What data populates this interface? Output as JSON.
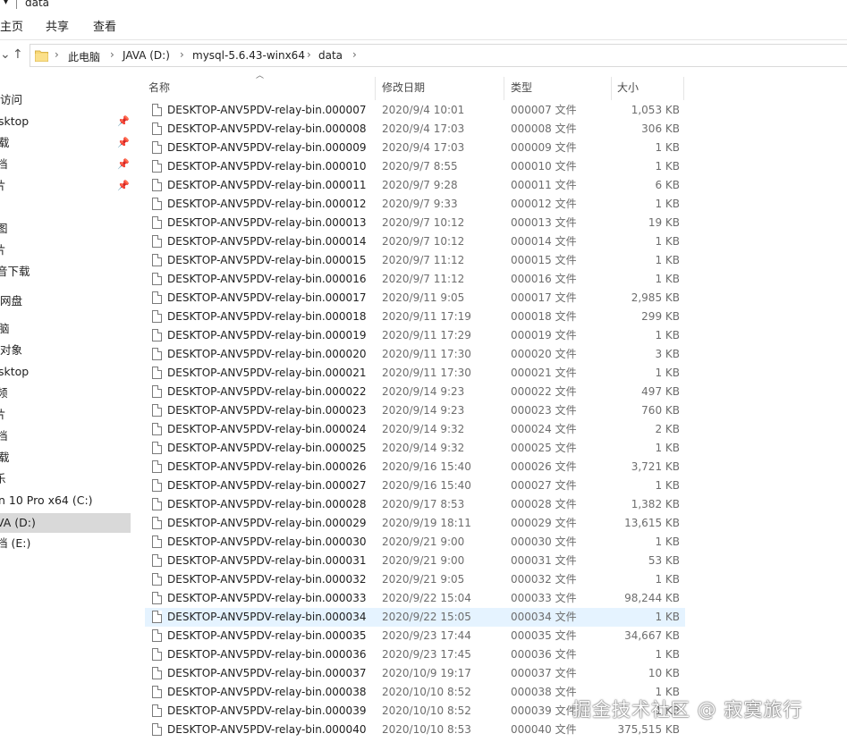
{
  "window": {
    "title": "data"
  },
  "ribbon": {
    "tabs": [
      "主页",
      "共享",
      "查看"
    ]
  },
  "address": {
    "crumbs": [
      "此电脑",
      "JAVA (D:)",
      "mysql-5.6.43-winx64",
      "data"
    ]
  },
  "nav": {
    "items": [
      {
        "label": "访问",
        "pinned": false
      },
      {
        "label": "sktop",
        "pinned": true
      },
      {
        "label": "载",
        "pinned": true
      },
      {
        "label": "档",
        "pinned": true
      },
      {
        "label": "片",
        "pinned": true
      },
      {
        "label": "图",
        "pinned": false
      },
      {
        "label": "片",
        "pinned": false
      },
      {
        "label": "音下载",
        "pinned": false
      },
      {
        "label": "网盘",
        "pinned": false
      },
      {
        "label": "脑",
        "pinned": false
      },
      {
        "label": "对象",
        "pinned": false
      },
      {
        "label": "sktop",
        "pinned": false
      },
      {
        "label": "频",
        "pinned": false
      },
      {
        "label": "片",
        "pinned": false
      },
      {
        "label": "档",
        "pinned": false
      },
      {
        "label": "载",
        "pinned": false
      },
      {
        "label": "乐",
        "pinned": false
      },
      {
        "label": "n 10 Pro x64 (C:)",
        "pinned": false
      },
      {
        "label": "VA (D:)",
        "pinned": false,
        "selected": true
      },
      {
        "label": "档 (E:)",
        "pinned": false
      }
    ]
  },
  "columns": {
    "name": "名称",
    "date": "修改日期",
    "type": "类型",
    "size": "大小"
  },
  "files": [
    {
      "name": "DESKTOP-ANV5PDV-relay-bin.000007",
      "date": "2020/9/4 10:01",
      "type": "000007 文件",
      "size": "1,053 KB"
    },
    {
      "name": "DESKTOP-ANV5PDV-relay-bin.000008",
      "date": "2020/9/4 17:03",
      "type": "000008 文件",
      "size": "306 KB"
    },
    {
      "name": "DESKTOP-ANV5PDV-relay-bin.000009",
      "date": "2020/9/4 17:03",
      "type": "000009 文件",
      "size": "1 KB"
    },
    {
      "name": "DESKTOP-ANV5PDV-relay-bin.000010",
      "date": "2020/9/7 8:55",
      "type": "000010 文件",
      "size": "1 KB"
    },
    {
      "name": "DESKTOP-ANV5PDV-relay-bin.000011",
      "date": "2020/9/7 9:28",
      "type": "000011 文件",
      "size": "6 KB"
    },
    {
      "name": "DESKTOP-ANV5PDV-relay-bin.000012",
      "date": "2020/9/7 9:33",
      "type": "000012 文件",
      "size": "1 KB"
    },
    {
      "name": "DESKTOP-ANV5PDV-relay-bin.000013",
      "date": "2020/9/7 10:12",
      "type": "000013 文件",
      "size": "19 KB"
    },
    {
      "name": "DESKTOP-ANV5PDV-relay-bin.000014",
      "date": "2020/9/7 10:12",
      "type": "000014 文件",
      "size": "1 KB"
    },
    {
      "name": "DESKTOP-ANV5PDV-relay-bin.000015",
      "date": "2020/9/7 11:12",
      "type": "000015 文件",
      "size": "1 KB"
    },
    {
      "name": "DESKTOP-ANV5PDV-relay-bin.000016",
      "date": "2020/9/7 11:12",
      "type": "000016 文件",
      "size": "1 KB"
    },
    {
      "name": "DESKTOP-ANV5PDV-relay-bin.000017",
      "date": "2020/9/11 9:05",
      "type": "000017 文件",
      "size": "2,985 KB"
    },
    {
      "name": "DESKTOP-ANV5PDV-relay-bin.000018",
      "date": "2020/9/11 17:19",
      "type": "000018 文件",
      "size": "299 KB"
    },
    {
      "name": "DESKTOP-ANV5PDV-relay-bin.000019",
      "date": "2020/9/11 17:29",
      "type": "000019 文件",
      "size": "1 KB"
    },
    {
      "name": "DESKTOP-ANV5PDV-relay-bin.000020",
      "date": "2020/9/11 17:30",
      "type": "000020 文件",
      "size": "3 KB"
    },
    {
      "name": "DESKTOP-ANV5PDV-relay-bin.000021",
      "date": "2020/9/11 17:30",
      "type": "000021 文件",
      "size": "1 KB"
    },
    {
      "name": "DESKTOP-ANV5PDV-relay-bin.000022",
      "date": "2020/9/14 9:23",
      "type": "000022 文件",
      "size": "497 KB"
    },
    {
      "name": "DESKTOP-ANV5PDV-relay-bin.000023",
      "date": "2020/9/14 9:23",
      "type": "000023 文件",
      "size": "760 KB"
    },
    {
      "name": "DESKTOP-ANV5PDV-relay-bin.000024",
      "date": "2020/9/14 9:32",
      "type": "000024 文件",
      "size": "2 KB"
    },
    {
      "name": "DESKTOP-ANV5PDV-relay-bin.000025",
      "date": "2020/9/14 9:32",
      "type": "000025 文件",
      "size": "1 KB"
    },
    {
      "name": "DESKTOP-ANV5PDV-relay-bin.000026",
      "date": "2020/9/16 15:40",
      "type": "000026 文件",
      "size": "3,721 KB"
    },
    {
      "name": "DESKTOP-ANV5PDV-relay-bin.000027",
      "date": "2020/9/16 15:40",
      "type": "000027 文件",
      "size": "1 KB"
    },
    {
      "name": "DESKTOP-ANV5PDV-relay-bin.000028",
      "date": "2020/9/17 8:53",
      "type": "000028 文件",
      "size": "1,382 KB"
    },
    {
      "name": "DESKTOP-ANV5PDV-relay-bin.000029",
      "date": "2020/9/19 18:11",
      "type": "000029 文件",
      "size": "13,615 KB"
    },
    {
      "name": "DESKTOP-ANV5PDV-relay-bin.000030",
      "date": "2020/9/21 9:00",
      "type": "000030 文件",
      "size": "1 KB"
    },
    {
      "name": "DESKTOP-ANV5PDV-relay-bin.000031",
      "date": "2020/9/21 9:00",
      "type": "000031 文件",
      "size": "53 KB"
    },
    {
      "name": "DESKTOP-ANV5PDV-relay-bin.000032",
      "date": "2020/9/21 9:05",
      "type": "000032 文件",
      "size": "1 KB"
    },
    {
      "name": "DESKTOP-ANV5PDV-relay-bin.000033",
      "date": "2020/9/22 15:04",
      "type": "000033 文件",
      "size": "98,244 KB"
    },
    {
      "name": "DESKTOP-ANV5PDV-relay-bin.000034",
      "date": "2020/9/22 15:05",
      "type": "000034 文件",
      "size": "1 KB",
      "selected": true
    },
    {
      "name": "DESKTOP-ANV5PDV-relay-bin.000035",
      "date": "2020/9/23 17:44",
      "type": "000035 文件",
      "size": "34,667 KB"
    },
    {
      "name": "DESKTOP-ANV5PDV-relay-bin.000036",
      "date": "2020/9/23 17:45",
      "type": "000036 文件",
      "size": "1 KB"
    },
    {
      "name": "DESKTOP-ANV5PDV-relay-bin.000037",
      "date": "2020/10/9 19:17",
      "type": "000037 文件",
      "size": "10 KB"
    },
    {
      "name": "DESKTOP-ANV5PDV-relay-bin.000038",
      "date": "2020/10/10 8:52",
      "type": "000038 文件",
      "size": "1 KB"
    },
    {
      "name": "DESKTOP-ANV5PDV-relay-bin.000039",
      "date": "2020/10/10 8:52",
      "type": "000039 文件",
      "size": "1 KB"
    },
    {
      "name": "DESKTOP-ANV5PDV-relay-bin.000040",
      "date": "2020/10/10 8:53",
      "type": "000040 文件",
      "size": "375,515 KB"
    }
  ],
  "watermark": "掘金技术社区 @ 寂寞旅行",
  "colors": {
    "selection": "#e5f3ff",
    "nav_selected": "#d9d9d9",
    "folder": "#f8d775"
  }
}
